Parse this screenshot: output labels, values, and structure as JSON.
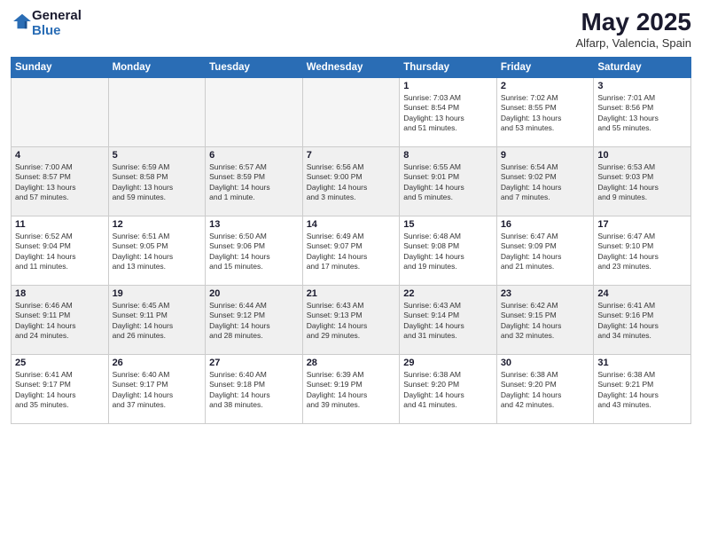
{
  "header": {
    "logo_general": "General",
    "logo_blue": "Blue",
    "month_title": "May 2025",
    "location": "Alfarp, Valencia, Spain"
  },
  "weekdays": [
    "Sunday",
    "Monday",
    "Tuesday",
    "Wednesday",
    "Thursday",
    "Friday",
    "Saturday"
  ],
  "weeks": [
    [
      {
        "day": "",
        "info": ""
      },
      {
        "day": "",
        "info": ""
      },
      {
        "day": "",
        "info": ""
      },
      {
        "day": "",
        "info": ""
      },
      {
        "day": "1",
        "info": "Sunrise: 7:03 AM\nSunset: 8:54 PM\nDaylight: 13 hours\nand 51 minutes."
      },
      {
        "day": "2",
        "info": "Sunrise: 7:02 AM\nSunset: 8:55 PM\nDaylight: 13 hours\nand 53 minutes."
      },
      {
        "day": "3",
        "info": "Sunrise: 7:01 AM\nSunset: 8:56 PM\nDaylight: 13 hours\nand 55 minutes."
      }
    ],
    [
      {
        "day": "4",
        "info": "Sunrise: 7:00 AM\nSunset: 8:57 PM\nDaylight: 13 hours\nand 57 minutes."
      },
      {
        "day": "5",
        "info": "Sunrise: 6:59 AM\nSunset: 8:58 PM\nDaylight: 13 hours\nand 59 minutes."
      },
      {
        "day": "6",
        "info": "Sunrise: 6:57 AM\nSunset: 8:59 PM\nDaylight: 14 hours\nand 1 minute."
      },
      {
        "day": "7",
        "info": "Sunrise: 6:56 AM\nSunset: 9:00 PM\nDaylight: 14 hours\nand 3 minutes."
      },
      {
        "day": "8",
        "info": "Sunrise: 6:55 AM\nSunset: 9:01 PM\nDaylight: 14 hours\nand 5 minutes."
      },
      {
        "day": "9",
        "info": "Sunrise: 6:54 AM\nSunset: 9:02 PM\nDaylight: 14 hours\nand 7 minutes."
      },
      {
        "day": "10",
        "info": "Sunrise: 6:53 AM\nSunset: 9:03 PM\nDaylight: 14 hours\nand 9 minutes."
      }
    ],
    [
      {
        "day": "11",
        "info": "Sunrise: 6:52 AM\nSunset: 9:04 PM\nDaylight: 14 hours\nand 11 minutes."
      },
      {
        "day": "12",
        "info": "Sunrise: 6:51 AM\nSunset: 9:05 PM\nDaylight: 14 hours\nand 13 minutes."
      },
      {
        "day": "13",
        "info": "Sunrise: 6:50 AM\nSunset: 9:06 PM\nDaylight: 14 hours\nand 15 minutes."
      },
      {
        "day": "14",
        "info": "Sunrise: 6:49 AM\nSunset: 9:07 PM\nDaylight: 14 hours\nand 17 minutes."
      },
      {
        "day": "15",
        "info": "Sunrise: 6:48 AM\nSunset: 9:08 PM\nDaylight: 14 hours\nand 19 minutes."
      },
      {
        "day": "16",
        "info": "Sunrise: 6:47 AM\nSunset: 9:09 PM\nDaylight: 14 hours\nand 21 minutes."
      },
      {
        "day": "17",
        "info": "Sunrise: 6:47 AM\nSunset: 9:10 PM\nDaylight: 14 hours\nand 23 minutes."
      }
    ],
    [
      {
        "day": "18",
        "info": "Sunrise: 6:46 AM\nSunset: 9:11 PM\nDaylight: 14 hours\nand 24 minutes."
      },
      {
        "day": "19",
        "info": "Sunrise: 6:45 AM\nSunset: 9:11 PM\nDaylight: 14 hours\nand 26 minutes."
      },
      {
        "day": "20",
        "info": "Sunrise: 6:44 AM\nSunset: 9:12 PM\nDaylight: 14 hours\nand 28 minutes."
      },
      {
        "day": "21",
        "info": "Sunrise: 6:43 AM\nSunset: 9:13 PM\nDaylight: 14 hours\nand 29 minutes."
      },
      {
        "day": "22",
        "info": "Sunrise: 6:43 AM\nSunset: 9:14 PM\nDaylight: 14 hours\nand 31 minutes."
      },
      {
        "day": "23",
        "info": "Sunrise: 6:42 AM\nSunset: 9:15 PM\nDaylight: 14 hours\nand 32 minutes."
      },
      {
        "day": "24",
        "info": "Sunrise: 6:41 AM\nSunset: 9:16 PM\nDaylight: 14 hours\nand 34 minutes."
      }
    ],
    [
      {
        "day": "25",
        "info": "Sunrise: 6:41 AM\nSunset: 9:17 PM\nDaylight: 14 hours\nand 35 minutes."
      },
      {
        "day": "26",
        "info": "Sunrise: 6:40 AM\nSunset: 9:17 PM\nDaylight: 14 hours\nand 37 minutes."
      },
      {
        "day": "27",
        "info": "Sunrise: 6:40 AM\nSunset: 9:18 PM\nDaylight: 14 hours\nand 38 minutes."
      },
      {
        "day": "28",
        "info": "Sunrise: 6:39 AM\nSunset: 9:19 PM\nDaylight: 14 hours\nand 39 minutes."
      },
      {
        "day": "29",
        "info": "Sunrise: 6:38 AM\nSunset: 9:20 PM\nDaylight: 14 hours\nand 41 minutes."
      },
      {
        "day": "30",
        "info": "Sunrise: 6:38 AM\nSunset: 9:20 PM\nDaylight: 14 hours\nand 42 minutes."
      },
      {
        "day": "31",
        "info": "Sunrise: 6:38 AM\nSunset: 9:21 PM\nDaylight: 14 hours\nand 43 minutes."
      }
    ]
  ]
}
